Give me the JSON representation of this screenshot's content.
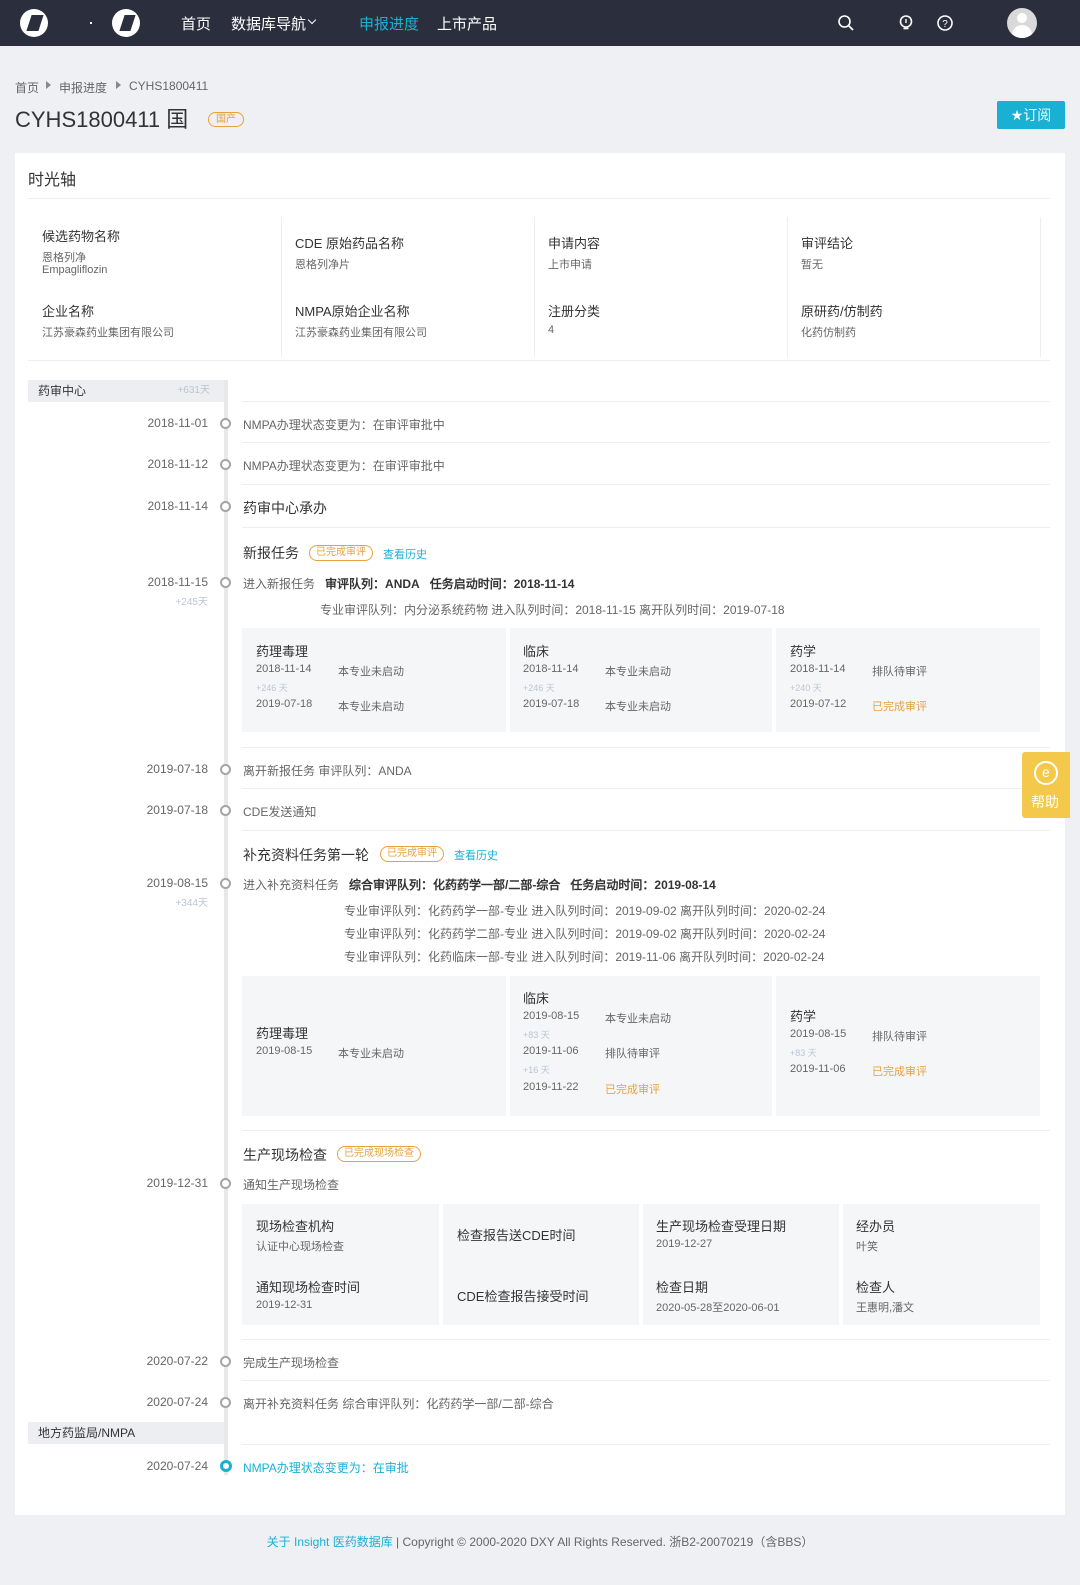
{
  "nav": {
    "items": [
      "首页",
      "数据库导航",
      "申报进度",
      "上市产品"
    ],
    "active": "申报进度",
    "icons": [
      "search-icon",
      "bulb-icon",
      "help-circle-icon",
      "user-avatar"
    ]
  },
  "breadcrumb": [
    "首页",
    "申报进度",
    "CYHS1800411"
  ],
  "header": {
    "title": "CYHS1800411 国",
    "tag": "国产",
    "subscribe": "★订阅"
  },
  "card": {
    "title": "时光轴",
    "info": [
      {
        "label": "候选药物名称",
        "values": [
          "恩格列净",
          "Empagliflozin"
        ]
      },
      {
        "label": "CDE 原始药品名称",
        "values": [
          "恩格列净片"
        ]
      },
      {
        "label": "申请内容",
        "values": [
          "上市申请"
        ]
      },
      {
        "label": "审评结论",
        "values": [
          "暂无"
        ]
      },
      {
        "label": "企业名称",
        "values": [
          "江苏豪森药业集团有限公司"
        ]
      },
      {
        "label": "NMPA原始企业名称",
        "values": [
          "江苏豪森药业集团有限公司"
        ]
      },
      {
        "label": "注册分类",
        "values": [
          "4"
        ]
      },
      {
        "label": "原研药/仿制药",
        "values": [
          "化药仿制药"
        ]
      }
    ]
  },
  "timeline": {
    "sec1": {
      "name": "药审中心",
      "days": "+631天"
    },
    "sec2": {
      "name": "地方药监局/NMPA"
    },
    "e1": {
      "date": "2018-11-01",
      "text": "NMPA办理状态变更为：在审评审批中"
    },
    "e2": {
      "date": "2018-11-12",
      "text": "NMPA办理状态变更为：在审评审批中"
    },
    "e3": {
      "date": "2018-11-14",
      "text": "药审中心承办"
    },
    "task1": {
      "title": "新报任务",
      "status": "已完成审评",
      "history": "查看历史",
      "date": "2018-11-15",
      "days": "+245天",
      "line_pre": "进入新报任务",
      "queue": "审评队列：ANDA",
      "start": "任务启动时间：2018-11-14",
      "sub": "专业审评队列：内分泌系统药物   进入队列时间：2018-11-15   离开队列时间：2019-07-18",
      "boxes": [
        {
          "title": "药理毒理",
          "r1d": "2018-11-14",
          "r1s": "本专业未启动",
          "plus": "+246 天",
          "r2d": "2019-07-18",
          "r2s": "本专业未启动"
        },
        {
          "title": "临床",
          "r1d": "2018-11-14",
          "r1s": "本专业未启动",
          "plus": "+246 天",
          "r2d": "2019-07-18",
          "r2s": "本专业未启动"
        },
        {
          "title": "药学",
          "r1d": "2018-11-14",
          "r1s": "排队待审评",
          "plus": "+240 天",
          "r2d": "2019-07-12",
          "r2s": "已完成审评"
        }
      ]
    },
    "e4": {
      "date": "2019-07-18",
      "text": "离开新报任务   审评队列：ANDA"
    },
    "e5": {
      "date": "2019-07-18",
      "text": "CDE发送通知"
    },
    "task2": {
      "title": "补充资料任务第一轮",
      "status": "已完成审评",
      "history": "查看历史",
      "date": "2019-08-15",
      "days": "+344天",
      "line_pre": "进入补充资料任务",
      "queue": "综合审评队列：化药药学一部/二部-综合",
      "start": "任务启动时间：2019-08-14",
      "subs": [
        "专业审评队列：化药药学一部-专业   进入队列时间：2019-09-02   离开队列时间：2020-02-24",
        "专业审评队列：化药药学二部-专业   进入队列时间：2019-09-02   离开队列时间：2020-02-24",
        "专业审评队列：化药临床一部-专业   进入队列时间：2019-11-06   离开队列时间：2020-02-24"
      ],
      "box1": {
        "title": "药理毒理",
        "d": "2019-08-15",
        "s": "本专业未启动"
      },
      "box2": {
        "title": "临床",
        "r1d": "2019-08-15",
        "r1s": "本专业未启动",
        "p1": "+83 天",
        "r2d": "2019-11-06",
        "r2s": "排队待审评",
        "p2": "+16 天",
        "r3d": "2019-11-22",
        "r3s": "已完成审评"
      },
      "box3": {
        "title": "药学",
        "r1d": "2019-08-15",
        "r1s": "排队待审评",
        "p1": "+83 天",
        "r2d": "2019-11-06",
        "r2s": "已完成审评"
      }
    },
    "task3": {
      "title": "生产现场检查",
      "status": "已完成现场检查",
      "date": "2019-12-31",
      "text": "通知生产现场检查",
      "grid": [
        {
          "label": "现场检查机构",
          "value": "认证中心现场检查"
        },
        {
          "label": "检查报告送CDE时间",
          "value": ""
        },
        {
          "label": "生产现场检查受理日期",
          "value": "2019-12-27"
        },
        {
          "label": "经办员",
          "value": "叶笑"
        },
        {
          "label": "通知现场检查时间",
          "value": "2019-12-31"
        },
        {
          "label": "CDE检查报告接受时间",
          "value": ""
        },
        {
          "label": "检查日期",
          "value": "2020-05-28至2020-06-01"
        },
        {
          "label": "检查人",
          "value": "王惠明,潘文"
        }
      ]
    },
    "e6": {
      "date": "2020-07-22",
      "text": "完成生产现场检查"
    },
    "e7": {
      "date": "2020-07-24",
      "text": "离开补充资料任务   综合审评队列：化药药学一部/二部-综合"
    },
    "e8": {
      "date": "2020-07-24",
      "text": "NMPA办理状态变更为：在审批"
    }
  },
  "help": {
    "label": "帮助"
  },
  "footer": {
    "link": "关于 Insight 医药数据库",
    "text": " | Copyright © 2000-2020 DXY All Rights Reserved. 浙B2-20070219（含BBS）"
  }
}
